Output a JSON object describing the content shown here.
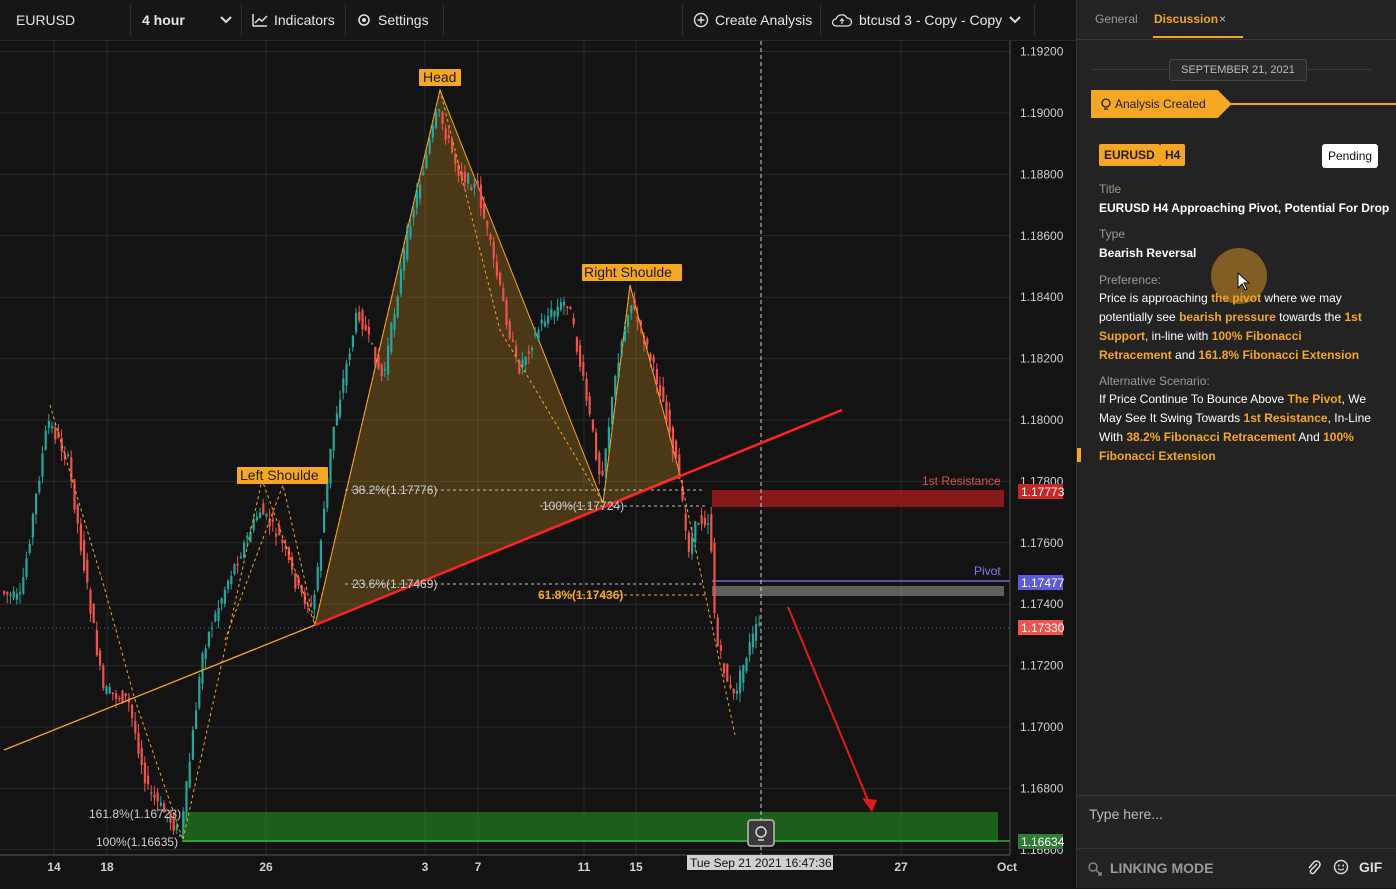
{
  "toolbar": {
    "symbol": "EURUSD",
    "interval": "4 hour",
    "indicators_label": "Indicators",
    "settings_label": "Settings",
    "create_label": "Create Analysis",
    "layout_label": "btcusd 3 - Copy - Copy"
  },
  "chart": {
    "price_labels": [
      "1.19200",
      "1.19000",
      "1.18800",
      "1.18600",
      "1.18400",
      "1.18200",
      "1.18000",
      "1.17800",
      "1.17600",
      "1.17400",
      "1.17200",
      "1.17000",
      "1.16800",
      "1.16600"
    ],
    "date_labels": [
      "14",
      "18",
      "26",
      "3",
      "7",
      "11",
      "15",
      "27",
      "Oct"
    ],
    "crosshair_date": "Tue Sep 21 2021 16:47:36",
    "pattern_labels": {
      "head": "Head",
      "left": "Left Shoulde",
      "right": "Right Shoulde"
    },
    "fib_labels": {
      "f382": "38.2%(1.17776)",
      "f100a": "100%(1.17724)",
      "f236": "23.6%(1.17469)",
      "f618": "61.8%(1.17436)",
      "f1618": "161.8%(1.16723)",
      "f100b": "100%(1.16635)"
    },
    "zone_labels": {
      "resistance": "1st Resistance",
      "pivot": "Pivot"
    },
    "badges": {
      "resistance": "1.17773",
      "pivot": "1.17477",
      "current": "1.17330",
      "support": "1.16634"
    },
    "colors": {
      "up": "#26a69a",
      "down": "#ef5350",
      "accent": "#f5a623",
      "resistance": "#9b1b1b",
      "support": "#1f7a1f",
      "pivot": "#6b6bd6"
    }
  },
  "panel": {
    "tab_general": "General",
    "tab_discussion": "Discussion",
    "date": "SEPTEMBER 21, 2021",
    "status_banner": "Analysis Created",
    "tags": [
      "EURUSD",
      "H4"
    ],
    "status": "Pending",
    "title_label": "Title",
    "title": "EURUSD H4 Approaching Pivot, Potential For Drop",
    "type_label": "Type",
    "type": "Bearish Reversal",
    "preference_label": "Preference:",
    "preference": {
      "t1": "Price is approaching ",
      "h1": "the pivot",
      "t2": " where we may potentially see ",
      "h2": "bearish pressure",
      "t3": " towards the ",
      "h3": "1st Support",
      "t4": ", in-line with ",
      "h4": "100% Fibonacci Retracement",
      "t5": " and ",
      "h5": "161.8% Fibonacci Extension"
    },
    "alt_label": "Alternative Scenario:",
    "alt": {
      "t1": "If Price Continue To Bounce Above ",
      "h1": "The Pivot",
      "t2": ", We May See It Swing Towards ",
      "h2": "1st Resistance",
      "t3": ", In-Line With ",
      "h3": "38.2% Fibonacci Retracement",
      "t4": " And ",
      "h4": "100% Fibonacci Extension"
    },
    "input_placeholder": "Type here...",
    "linking_mode": "LINKING MODE",
    "gif_label": "GIF"
  }
}
